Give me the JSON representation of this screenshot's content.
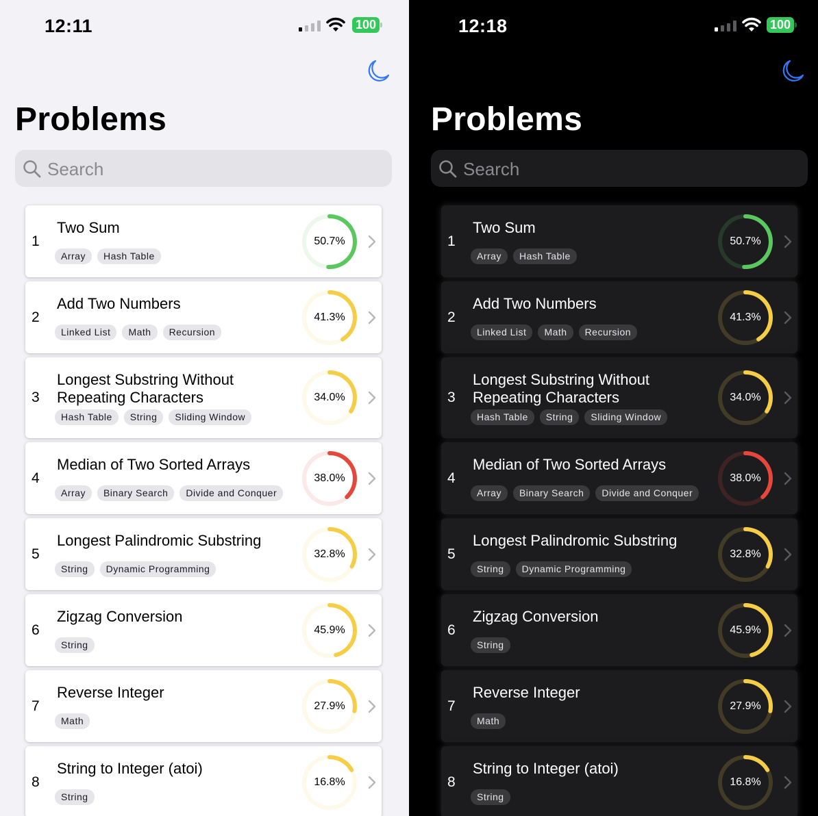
{
  "light": {
    "time": "12:11",
    "battery": "100",
    "title": "Problems",
    "search_placeholder": "Search"
  },
  "dark": {
    "time": "12:18",
    "battery": "100",
    "title": "Problems",
    "search_placeholder": "Search"
  },
  "colors": {
    "green": "#5ac85e",
    "yellow": "#f5cd47",
    "red": "#e5473b"
  },
  "icons": {
    "theme_toggle": "moon-icon",
    "search": "magnifying-glass-icon",
    "disclosure": "chevron-right-icon"
  },
  "problems": [
    {
      "num": "1",
      "title": "Two Sum",
      "tags": [
        "Array",
        "Hash Table"
      ],
      "rate": "50.7%",
      "value": 50.7,
      "color": "green"
    },
    {
      "num": "2",
      "title": "Add Two Numbers",
      "tags": [
        "Linked List",
        "Math",
        "Recursion"
      ],
      "rate": "41.3%",
      "value": 41.3,
      "color": "yellow"
    },
    {
      "num": "3",
      "title": "Longest Substring Without Repeating Characters",
      "tags": [
        "Hash Table",
        "String",
        "Sliding Window"
      ],
      "rate": "34.0%",
      "value": 34.0,
      "color": "yellow"
    },
    {
      "num": "4",
      "title": "Median of Two Sorted Arrays",
      "tags": [
        "Array",
        "Binary Search",
        "Divide and Conquer"
      ],
      "rate": "38.0%",
      "value": 38.0,
      "color": "red"
    },
    {
      "num": "5",
      "title": "Longest Palindromic Substring",
      "tags": [
        "String",
        "Dynamic Programming"
      ],
      "rate": "32.8%",
      "value": 32.8,
      "color": "yellow"
    },
    {
      "num": "6",
      "title": "Zigzag Conversion",
      "tags": [
        "String"
      ],
      "rate": "45.9%",
      "value": 45.9,
      "color": "yellow"
    },
    {
      "num": "7",
      "title": "Reverse Integer",
      "tags": [
        "Math"
      ],
      "rate": "27.9%",
      "value": 27.9,
      "color": "yellow"
    },
    {
      "num": "8",
      "title": "String to Integer (atoi)",
      "tags": [
        "String"
      ],
      "rate": "16.8%",
      "value": 16.8,
      "color": "yellow"
    }
  ]
}
